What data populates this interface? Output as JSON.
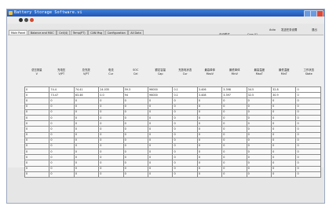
{
  "window": {
    "title": "Battery Storage Software.vi",
    "accent": "#2e6ad0"
  },
  "toolbar": {
    "icons": [
      "run-icon",
      "pause-icon",
      "stop-icon"
    ]
  },
  "tabs": [
    {
      "label": "Main Panel",
      "active": true
    },
    {
      "label": "Balance and MUC"
    },
    {
      "label": "Cell(4)"
    },
    {
      "label": "Temp(PT)"
    },
    {
      "label": "CAN Msg"
    },
    {
      "label": "Configuration"
    },
    {
      "label": "All Data"
    }
  ],
  "controls": {
    "mode_label": "自动模式",
    "startup_label": "Startup Lines",
    "com_label": "Com 01",
    "status_label": "正常",
    "status_color": "#2fa02f",
    "auto_label": "Auto",
    "auto_color": "#f19520",
    "send_label": "发送任务设置",
    "send_value": "Comm/Start/Pn",
    "send_color": "#2b8fe0",
    "exit_label": "退出",
    "exit_value": "Exit",
    "exit_color": "#2b8fe0"
  },
  "table": {
    "headers": [
      [
        "总压测量",
        "V"
      ],
      [
        "充电压",
        "V/PT"
      ],
      [
        "总充放",
        "V/PT"
      ],
      [
        "电流",
        "Cur"
      ],
      [
        "SOC",
        "Cel"
      ],
      [
        "额定容量",
        "Cap"
      ],
      [
        "充放电状态",
        "Cur"
      ],
      [
        "最高单体",
        "MaxV"
      ],
      [
        "最低单体",
        "MinV"
      ],
      [
        "最高温度",
        "MaxT"
      ],
      [
        "最低温度",
        "MinT"
      ],
      [
        "工作状态",
        "State"
      ]
    ],
    "rows": [
      [
        "0",
        "74.4",
        "74.41",
        "24.035",
        "59.3",
        "96000",
        "0.1",
        "3.406",
        "3.398",
        "34.5",
        "32.8",
        "0"
      ],
      [
        "0",
        "73.47",
        "63.46",
        "0.0",
        "94",
        "96000",
        "0.1",
        "3.408",
        "3.397",
        "32.5",
        "30.9",
        "0"
      ],
      [
        "0",
        "0",
        "0",
        "0",
        "0",
        "0",
        "0",
        "0",
        "0",
        "0",
        "0",
        "0"
      ],
      [
        "0",
        "0",
        "0",
        "0",
        "0",
        "0",
        "0",
        "0",
        "0",
        "0",
        "0",
        "0"
      ],
      [
        "0",
        "0",
        "0",
        "0",
        "0",
        "0",
        "0",
        "0",
        "0",
        "0",
        "0",
        "0"
      ],
      [
        "0",
        "0",
        "0",
        "0",
        "0",
        "0",
        "0",
        "0",
        "0",
        "0",
        "0",
        "0"
      ],
      [
        "0",
        "0",
        "0",
        "0",
        "0",
        "0",
        "0",
        "0",
        "0",
        "0",
        "0",
        "0"
      ],
      [
        "0",
        "0",
        "0",
        "0",
        "0",
        "0",
        "0",
        "0",
        "0",
        "0",
        "0",
        "0"
      ],
      [
        "0",
        "0",
        "0",
        "0",
        "0",
        "0",
        "0",
        "0",
        "0",
        "0",
        "0",
        "0"
      ],
      [
        "0",
        "0",
        "0",
        "0",
        "0",
        "0",
        "0",
        "0",
        "0",
        "0",
        "0",
        "0"
      ],
      [
        "0",
        "0",
        "0",
        "0",
        "0",
        "0",
        "0",
        "0",
        "0",
        "0",
        "0",
        "0"
      ],
      [
        "0",
        "0",
        "0",
        "0",
        "0",
        "0",
        "0",
        "0",
        "0",
        "0",
        "0",
        "0"
      ],
      [
        "0",
        "0",
        "0",
        "0",
        "0",
        "0",
        "0",
        "0",
        "0",
        "0",
        "0",
        "0"
      ],
      [
        "0",
        "0",
        "0",
        "0",
        "0",
        "0",
        "0",
        "0",
        "0",
        "0",
        "0",
        "0"
      ],
      [
        "0",
        "0",
        "0",
        "0",
        "0",
        "0",
        "0",
        "0",
        "0",
        "0",
        "0",
        "0"
      ],
      [
        "0",
        "0",
        "0",
        "0",
        "0",
        "0",
        "0",
        "0",
        "0",
        "0",
        "0",
        "0"
      ]
    ]
  }
}
